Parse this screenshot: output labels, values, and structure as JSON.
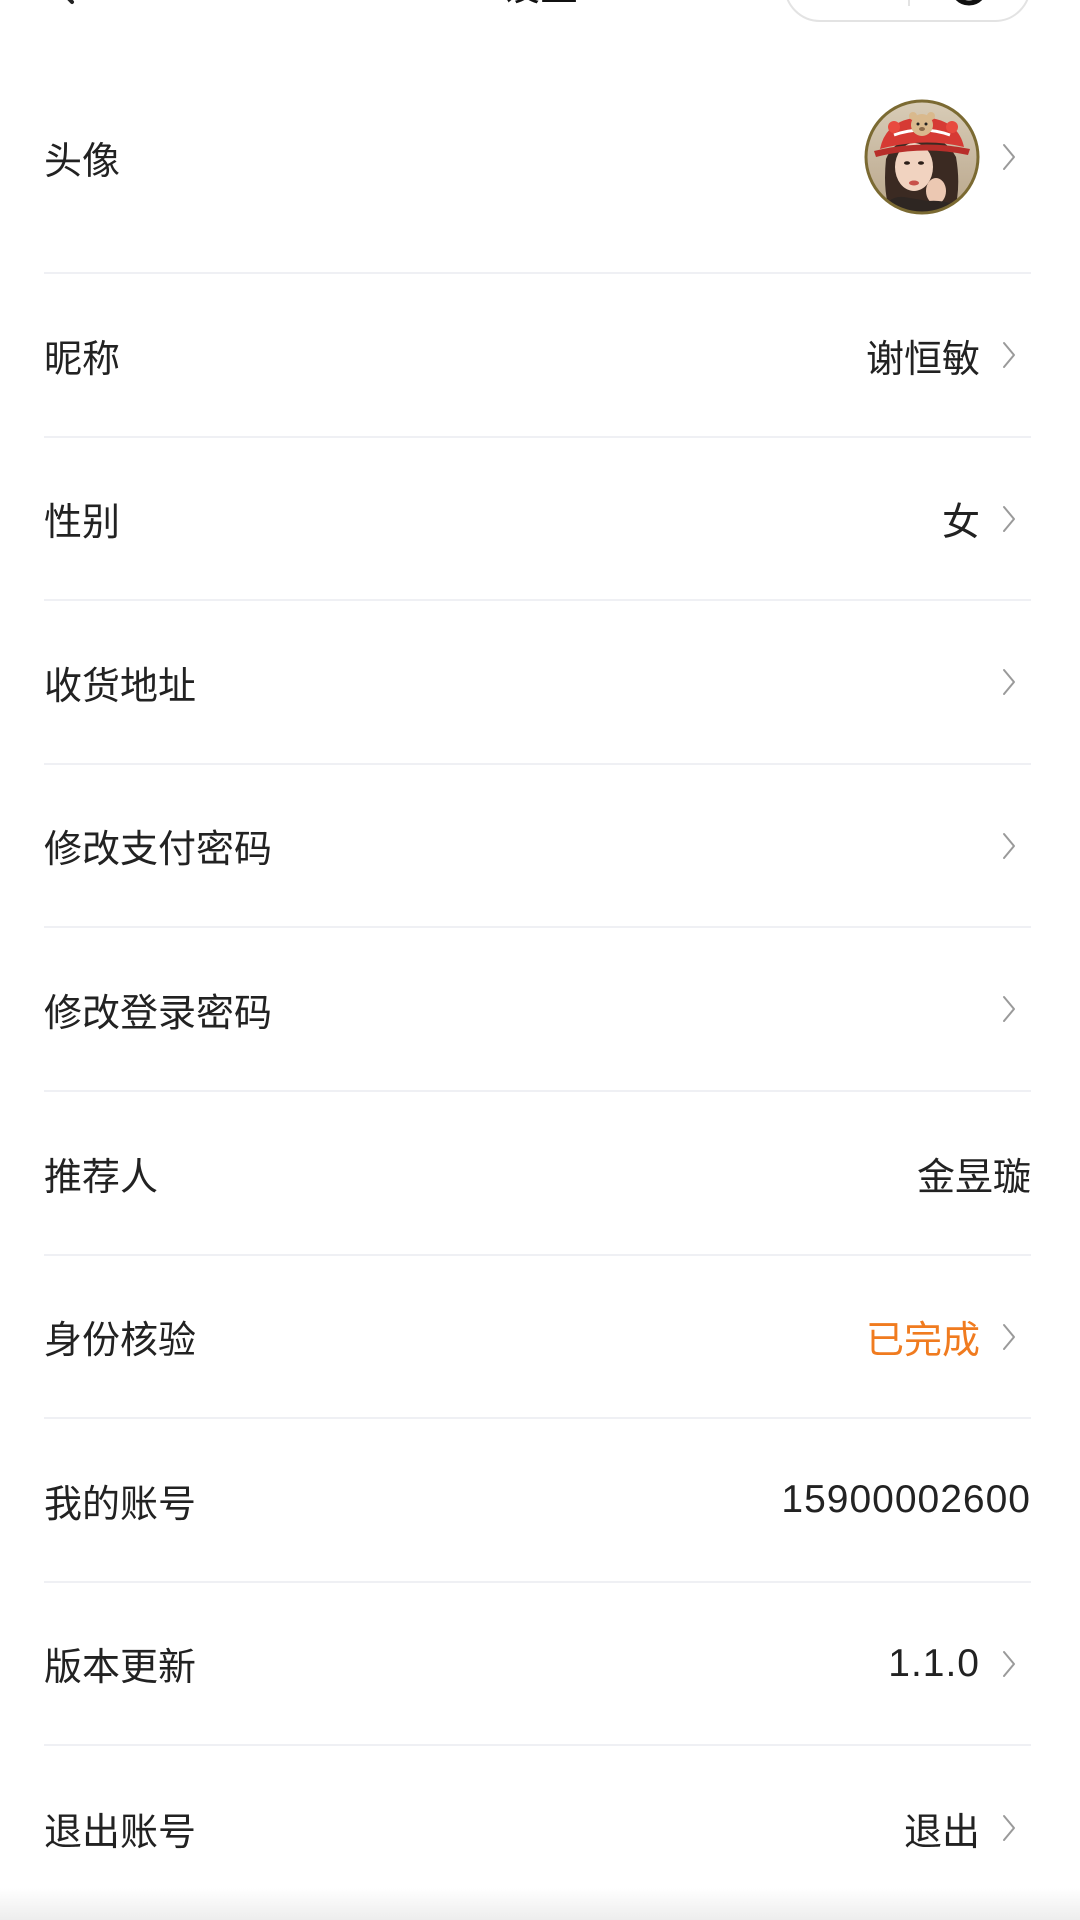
{
  "header": {
    "title": "设置"
  },
  "rows": [
    {
      "label": "头像"
    },
    {
      "label": "昵称",
      "value": "谢恒敏"
    },
    {
      "label": "性别",
      "value": "女"
    },
    {
      "label": "收货地址"
    },
    {
      "label": "修改支付密码"
    },
    {
      "label": "修改登录密码"
    },
    {
      "label": "推荐人",
      "value": "金昱璇"
    },
    {
      "label": "身份核验",
      "value": "已完成"
    },
    {
      "label": "我的账号",
      "value": "15900002600"
    },
    {
      "label": "版本更新",
      "value": "1.1.0"
    },
    {
      "label": "退出账号",
      "value": "退出"
    }
  ],
  "icons": {
    "back": "back-icon",
    "more": "more-dots-icon",
    "close": "close-circle-icon",
    "chevron": "chevron-right-icon",
    "avatar": "avatar"
  },
  "colors": {
    "text": "#222222",
    "status_done": "#f07b1f",
    "divider": "#eff0f4",
    "chevron": "#9a9a9a",
    "capsule_border": "#e3e3e3"
  }
}
